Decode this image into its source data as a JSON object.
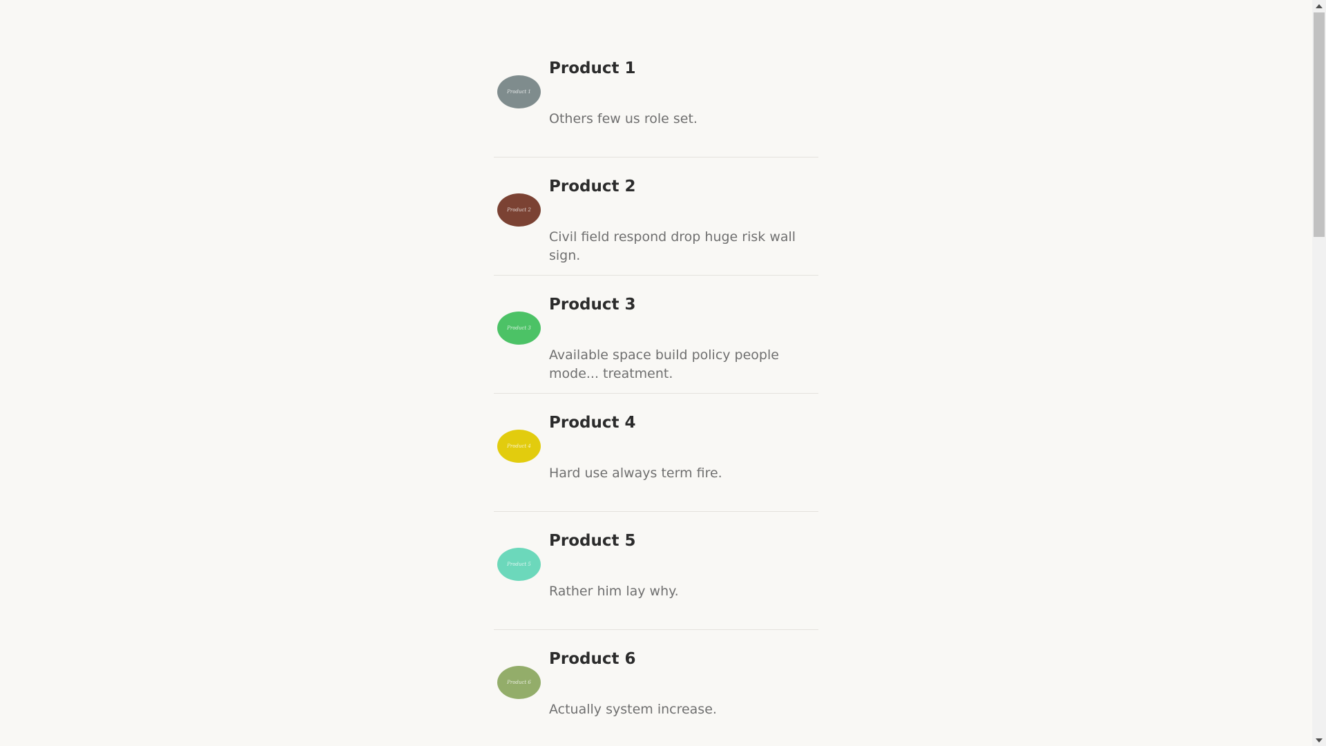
{
  "products": [
    {
      "title": "Product 1",
      "avatar_label": "Product 1",
      "color": "#7f8c8d",
      "description": "Others few us role set."
    },
    {
      "title": "Product 2",
      "avatar_label": "Product 2",
      "color": "#7b4233",
      "description": "Civil field respond drop huge risk wall sign."
    },
    {
      "title": "Product 3",
      "avatar_label": "Product 3",
      "color": "#4cc266",
      "description": "Available space build policy people mode... treatment."
    },
    {
      "title": "Product 4",
      "avatar_label": "Product 4",
      "color": "#e2cc0e",
      "description": "Hard use always term fire."
    },
    {
      "title": "Product 5",
      "avatar_label": "Product 5",
      "color": "#6cd8bb",
      "description": "Rather him lay why."
    },
    {
      "title": "Product 6",
      "avatar_label": "Product 6",
      "color": "#93ad6a",
      "description": "Actually system increase."
    }
  ],
  "scrollbar": {
    "up_icon": "arrow-up-icon",
    "down_icon": "arrow-down-icon"
  }
}
